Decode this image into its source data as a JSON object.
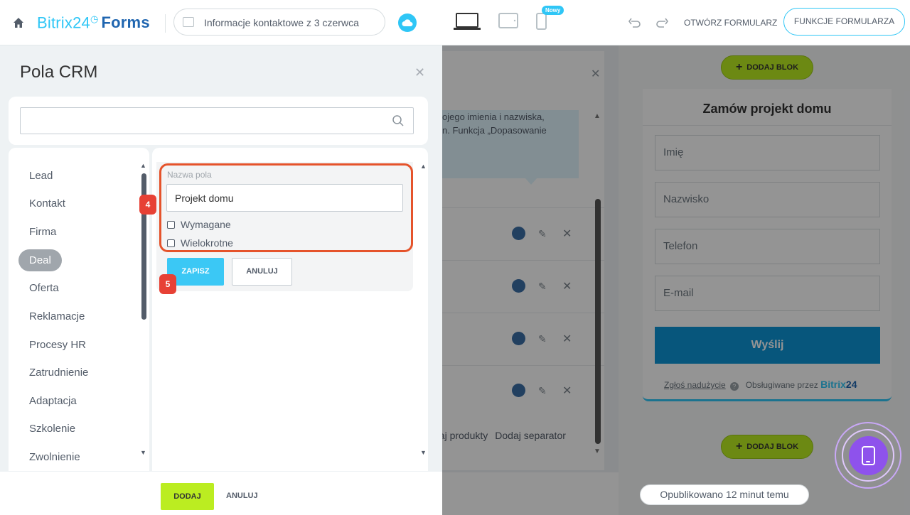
{
  "topbar": {
    "brand_name": "Bitrix24",
    "brand_clock": "◷",
    "brand_product": "Forms",
    "form_name": "Informacje kontaktowe z 3 czerwca",
    "new_badge": "Nowy",
    "open_form": "OTWÓRZ FORMULARZ",
    "form_functions": "FUNKCJE FORMULARZA"
  },
  "panel": {
    "title": "Pola CRM",
    "search_placeholder": "",
    "categories": [
      {
        "label": "Lead"
      },
      {
        "label": "Kontakt"
      },
      {
        "label": "Firma"
      },
      {
        "label": "Deal"
      },
      {
        "label": "Oferta"
      },
      {
        "label": "Reklamacje"
      },
      {
        "label": "Procesy HR"
      },
      {
        "label": "Zatrudnienie"
      },
      {
        "label": "Adaptacja"
      },
      {
        "label": "Szkolenie"
      },
      {
        "label": "Zwolnienie"
      }
    ],
    "active_category": "Deal",
    "field_label": "Nazwa pola",
    "field_value": "Projekt domu",
    "required_label": "Wymagane",
    "multiple_label": "Wielokrotne",
    "save_label": "ZAPISZ",
    "cancel_label": "ANULUJ",
    "step_4": "4",
    "step_5": "5",
    "footer_add": "DODAJ",
    "footer_cancel": "ANULUJ"
  },
  "editor": {
    "hint_line1": "ojego imienia i nazwiska,",
    "hint_line2": "n. Funkcja „Dopasowanie",
    "link_products": "daj produkty",
    "link_separator": "Dodaj separator"
  },
  "preview": {
    "add_block": "DODAJ BLOK",
    "title": "Zamów projekt domu",
    "fields": [
      "Imię",
      "Nazwisko",
      "Telefon",
      "E-mail"
    ],
    "submit": "Wyślij",
    "abuse": "Zgłoś nadużycie",
    "qmark": "?",
    "powered_by": "Obsługiwane przez",
    "b24_a": "Bitrix",
    "b24_b": "24",
    "published": "Opublikowano 12 minut temu"
  },
  "colors": {
    "accent": "#2fc6f6",
    "highlight": "#e5532b",
    "step_badge": "#e74135",
    "add_green": "#bbed21",
    "submit_blue": "#0d94d6",
    "fab_purple": "#8e52ec"
  }
}
